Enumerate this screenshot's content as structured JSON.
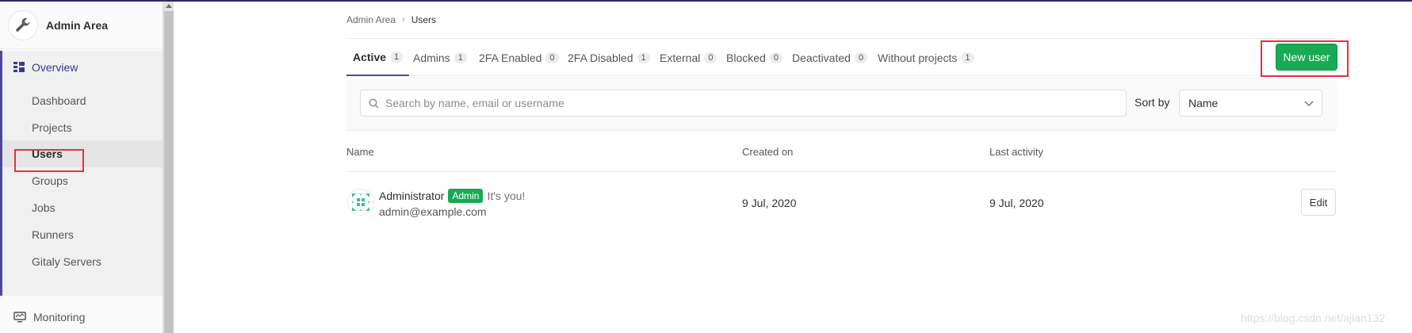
{
  "sidebar": {
    "title": "Admin Area",
    "header_icon": "wrench-icon",
    "overview_label": "Overview",
    "overview_icon": "overview-grid-icon",
    "items": [
      {
        "label": "Dashboard"
      },
      {
        "label": "Projects"
      },
      {
        "label": "Users",
        "active": true
      },
      {
        "label": "Groups"
      },
      {
        "label": "Jobs"
      },
      {
        "label": "Runners"
      },
      {
        "label": "Gitaly Servers"
      }
    ],
    "monitoring_label": "Monitoring",
    "monitoring_icon": "monitor-icon"
  },
  "breadcrumb": {
    "parent": "Admin Area",
    "current": "Users"
  },
  "tabs": [
    {
      "label": "Active",
      "count": "1",
      "active": true
    },
    {
      "label": "Admins",
      "count": "1"
    },
    {
      "label": "2FA Enabled",
      "count": "0"
    },
    {
      "label": "2FA Disabled",
      "count": "1"
    },
    {
      "label": "External",
      "count": "0"
    },
    {
      "label": "Blocked",
      "count": "0"
    },
    {
      "label": "Deactivated",
      "count": "0"
    },
    {
      "label": "Without projects",
      "count": "1"
    }
  ],
  "new_user_label": "New user",
  "search": {
    "placeholder": "Search by name, email or username",
    "value": ""
  },
  "sort": {
    "label": "Sort by",
    "selected": "Name"
  },
  "table": {
    "headers": {
      "name": "Name",
      "created": "Created on",
      "activity": "Last activity"
    },
    "rows": [
      {
        "name": "Administrator",
        "badge": "Admin",
        "note": "It's you!",
        "email": "admin@example.com",
        "created": "9 Jul, 2020",
        "last_activity": "9 Jul, 2020",
        "action": "Edit"
      }
    ]
  },
  "colors": {
    "accent": "#4c4a98",
    "success": "#1aaa55",
    "highlight": "#e0343a"
  },
  "watermark": "https://blog.csdn.net/ajian132"
}
